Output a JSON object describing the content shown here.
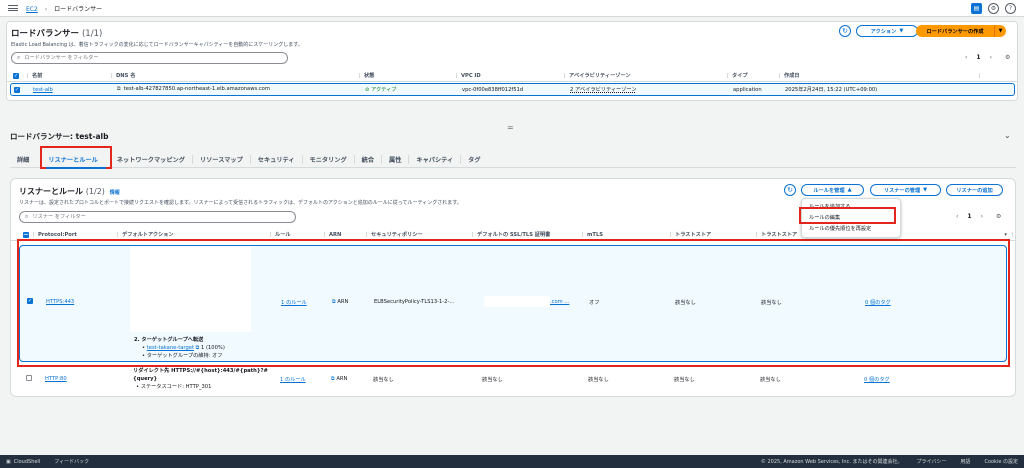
{
  "topbar": {
    "breadcrumb": [
      "EC2",
      "ロードバランサー"
    ],
    "icons": [
      "notifications-icon",
      "settings-icon",
      "help-icon"
    ]
  },
  "lb": {
    "title": "ロードバランサー",
    "count": "(1/1)",
    "description": "Elastic Load Balancing は、着信トラフィックの変化に応じてロードバランサーキャパシティーを自動的にスケーリングします。",
    "actions_label": "アクション",
    "create_label": "ロードバランサーの作成",
    "search_placeholder": "ロードバランサー をフィルター",
    "page": "1",
    "columns": [
      "名前",
      "DNS 名",
      "状態",
      "VPC ID",
      "アベイラビリティーゾーン",
      "タイプ",
      "作成日"
    ],
    "row": {
      "name": "test-alb",
      "dns": "test-alb-427827850.ap-northeast-1.elb.amazonaws.com",
      "state": "アクティブ",
      "vpc": "vpc-0f00e838ff012f51d",
      "az": "2 アベイラビリティーゾーン",
      "type": "application",
      "created": "2025年2月24日, 15:22 (UTC+09:00)"
    }
  },
  "drag_handle": "=",
  "detail": {
    "title": "ロードバランサー: test-alb",
    "tabs": [
      "詳細",
      "リスナーとルール",
      "ネットワークマッピング",
      "リソースマップ",
      "セキュリティ",
      "モニタリング",
      "統合",
      "属性",
      "キャパシティ",
      "タグ"
    ],
    "selected_tab": 1
  },
  "listeners": {
    "title": "リスナーとルール",
    "count": "(1/2)",
    "info": "情報",
    "description": "リスナーは、設定されたプロトコルとポートで接続リクエストを確認します。リスナーによって受信されるトラフィックは、デフォルトのアクションと追加のルールに従ってルーティングされます。",
    "manage_rules": "ルールを管理",
    "manage_listener": "リスナーの管理",
    "add_listener": "リスナーの追加",
    "search_placeholder": "リスナー をフィルター",
    "page": "1",
    "columns": [
      "Protocol:Port",
      "デフォルトアクション",
      "ルール",
      "ARN",
      "セキュリティポリシー",
      "デフォルトの SSL/TLS 証明書",
      "mTLS",
      "トラストストア",
      "トラストストア"
    ],
    "dropdown": [
      "ルールを追加する",
      "ルールの編集",
      "ルールの優先順位を再設定"
    ],
    "rows": [
      {
        "protocol": "HTTPS:443",
        "action_title": "2. ターゲットグループへ転送",
        "action_target": "test-takane-target",
        "action_weight": "1 (100%)",
        "action_stickiness": "ターゲットグループの維持: オフ",
        "rules": "1 のルール",
        "arn": "ARN",
        "policy": "ELBSecurityPolicy-TLS13-1-2-...",
        "cert": ".com ...",
        "mtls": "オフ",
        "trust1": "該当なし",
        "trust2": "該当なし",
        "tags": "0 個のタグ"
      },
      {
        "protocol": "HTTP:80",
        "action_line1": "リダイレクト先 HTTPS://#{host}:443/#{path}?#",
        "action_line2": "{query}",
        "action_line3": "ステータスコード: HTTP_301",
        "rules": "1 のルール",
        "arn": "ARN",
        "policy": "該当なし",
        "cert": "該当なし",
        "mtls": "該当なし",
        "trust1": "該当なし",
        "trust2": "該当なし",
        "tags": "0 個のタグ"
      }
    ]
  },
  "footer": {
    "cloudshell": "CloudShell",
    "feedback": "フィードバック",
    "copyright": "© 2025, Amazon Web Services, Inc. またはその関連会社。",
    "privacy": "プライバシー",
    "terms": "用語",
    "cookie": "Cookie の設定"
  }
}
